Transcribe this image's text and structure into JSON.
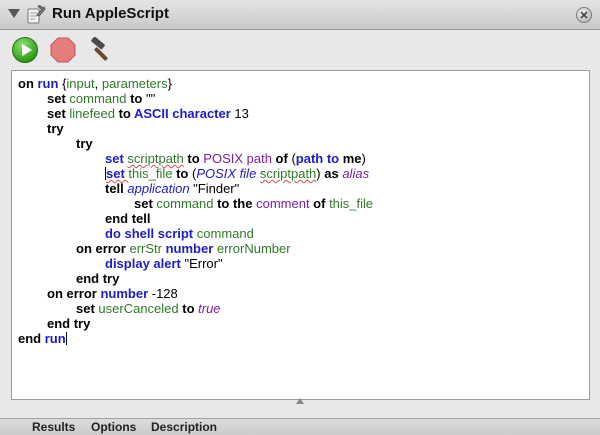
{
  "window": {
    "title": "Run AppleScript"
  },
  "toolbar": {
    "run": "run-icon",
    "stop": "stop-icon",
    "compile": "hammer-icon"
  },
  "tabs": [
    "Results",
    "Options",
    "Description"
  ],
  "colors": {
    "keyword": "#1c1cc8",
    "variable": "#2f7b2a",
    "property": "#7a1fa6"
  },
  "code": [
    {
      "indent": 0,
      "parts": [
        {
          "t": "on ",
          "c": "k blk"
        },
        {
          "t": "run",
          "c": "k"
        },
        {
          "t": " {",
          "c": ""
        },
        {
          "t": "input",
          "c": "v"
        },
        {
          "t": ", ",
          "c": ""
        },
        {
          "t": "parameters",
          "c": "v"
        },
        {
          "t": "}",
          "c": ""
        }
      ]
    },
    {
      "indent": 1,
      "parts": [
        {
          "t": "set ",
          "c": "k blk"
        },
        {
          "t": "command",
          "c": "v"
        },
        {
          "t": " to ",
          "c": "k blk"
        },
        {
          "t": "\"\"",
          "c": "str"
        }
      ]
    },
    {
      "indent": 1,
      "parts": [
        {
          "t": "set ",
          "c": "k blk"
        },
        {
          "t": "linefeed",
          "c": "v"
        },
        {
          "t": " to ",
          "c": "k blk"
        },
        {
          "t": "ASCII character",
          "c": "k"
        },
        {
          "t": " 13",
          "c": ""
        }
      ]
    },
    {
      "indent": 1,
      "parts": [
        {
          "t": "try",
          "c": "k blk"
        }
      ]
    },
    {
      "indent": 2,
      "parts": [
        {
          "t": "try",
          "c": "k blk"
        }
      ]
    },
    {
      "indent": 3,
      "parts": [
        {
          "t": "set ",
          "c": "k"
        },
        {
          "t": "scriptpath",
          "c": "v u"
        },
        {
          "t": " to ",
          "c": "k blk"
        },
        {
          "t": "POSIX path",
          "c": "p"
        },
        {
          "t": " of ",
          "c": "k blk"
        },
        {
          "t": "(",
          "c": ""
        },
        {
          "t": "path to",
          "c": "k"
        },
        {
          "t": " me",
          "c": "k blk"
        },
        {
          "t": ")",
          "c": ""
        }
      ]
    },
    {
      "indent": 3,
      "cursor": true,
      "parts": [
        {
          "t": "set ",
          "c": "k u"
        },
        {
          "t": "this_file",
          "c": "v"
        },
        {
          "t": " to ",
          "c": "k blk"
        },
        {
          "t": "(",
          "c": ""
        },
        {
          "t": "POSIX file",
          "c": "cls"
        },
        {
          "t": " ",
          "c": ""
        },
        {
          "t": "scriptpath",
          "c": "v u"
        },
        {
          "t": ")",
          "c": ""
        },
        {
          "t": " as ",
          "c": "k blk"
        },
        {
          "t": "alias",
          "c": "c"
        }
      ]
    },
    {
      "indent": 3,
      "parts": [
        {
          "t": "tell ",
          "c": "k blk"
        },
        {
          "t": "application",
          "c": "cls"
        },
        {
          "t": " \"Finder\"",
          "c": "str"
        }
      ]
    },
    {
      "indent": 4,
      "parts": [
        {
          "t": "set ",
          "c": "k blk"
        },
        {
          "t": "command",
          "c": "v"
        },
        {
          "t": " to the ",
          "c": "k blk"
        },
        {
          "t": "comment",
          "c": "p"
        },
        {
          "t": " of ",
          "c": "k blk"
        },
        {
          "t": "this_file",
          "c": "v"
        }
      ]
    },
    {
      "indent": 3,
      "parts": [
        {
          "t": "end tell",
          "c": "k blk"
        }
      ]
    },
    {
      "indent": 3,
      "parts": [
        {
          "t": "do shell script",
          "c": "k"
        },
        {
          "t": " ",
          "c": ""
        },
        {
          "t": "command",
          "c": "v"
        }
      ]
    },
    {
      "indent": 2,
      "parts": [
        {
          "t": "on error ",
          "c": "k blk"
        },
        {
          "t": "errStr",
          "c": "v"
        },
        {
          "t": " number ",
          "c": "k"
        },
        {
          "t": "errorNumber",
          "c": "v"
        }
      ]
    },
    {
      "indent": 3,
      "parts": [
        {
          "t": "display alert",
          "c": "k"
        },
        {
          "t": " \"Error\"",
          "c": "str"
        }
      ]
    },
    {
      "indent": 2,
      "parts": [
        {
          "t": "end try",
          "c": "k blk"
        }
      ]
    },
    {
      "indent": 1,
      "parts": [
        {
          "t": "on error ",
          "c": "k blk"
        },
        {
          "t": "number",
          "c": "k"
        },
        {
          "t": " -128",
          "c": ""
        }
      ]
    },
    {
      "indent": 2,
      "parts": [
        {
          "t": "set ",
          "c": "k blk"
        },
        {
          "t": "userCanceled",
          "c": "v"
        },
        {
          "t": " to ",
          "c": "k blk"
        },
        {
          "t": "true",
          "c": "c"
        }
      ]
    },
    {
      "indent": 1,
      "parts": [
        {
          "t": "end try",
          "c": "k blk"
        }
      ]
    },
    {
      "indent": 0,
      "endcursor": true,
      "parts": [
        {
          "t": "end ",
          "c": "k blk"
        },
        {
          "t": "run",
          "c": "k"
        }
      ]
    }
  ]
}
